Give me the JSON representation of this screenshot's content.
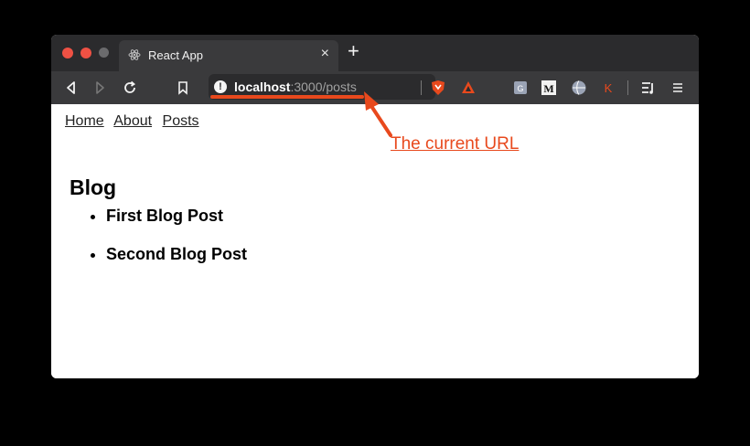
{
  "browser": {
    "tab_title": "React App",
    "tab_close": "×",
    "new_tab": "+",
    "url_host": "localhost",
    "url_rest": ":3000/posts",
    "url_alert": "!"
  },
  "page": {
    "nav": [
      "Home",
      "About",
      "Posts"
    ],
    "heading": "Blog",
    "posts": [
      "First Blog Post",
      "Second Blog Post"
    ]
  },
  "annotation": {
    "label": "The current URL",
    "color": "#e8491d"
  },
  "colors": {
    "tab_strip": "#2b2b2d",
    "toolbar": "#3a3a3c",
    "close_dot": "#ee5144"
  },
  "extensions": [
    "brave-shield-icon",
    "brave-rewards-icon",
    "translate-icon",
    "medium-icon",
    "globe-icon",
    "k-extension-icon",
    "reading-list-icon",
    "menu-icon"
  ]
}
